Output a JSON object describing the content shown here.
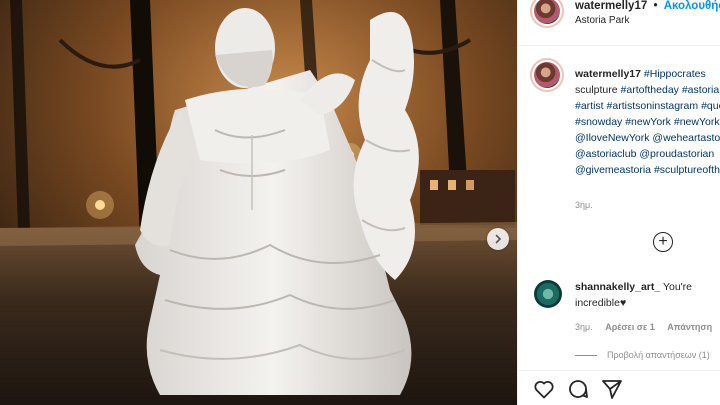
{
  "header": {
    "username": "watermelly17",
    "separator": "•",
    "follow_label": "Ακολουθήστε",
    "location": "Astoria Park"
  },
  "caption": {
    "username": "watermelly17",
    "text_parts": [
      {
        "kind": "tag",
        "text": "#Hippocrates"
      },
      {
        "kind": "text",
        "text": " sculpture "
      },
      {
        "kind": "tag",
        "text": "#artoftheday"
      },
      {
        "kind": "text",
        "text": " "
      },
      {
        "kind": "tag",
        "text": "#astoria"
      },
      {
        "kind": "text",
        "text": " "
      },
      {
        "kind": "tag",
        "text": "#artist"
      },
      {
        "kind": "text",
        "text": " "
      },
      {
        "kind": "tag",
        "text": "#artistsoninstagram"
      },
      {
        "kind": "text",
        "text": " "
      },
      {
        "kind": "tag",
        "text": "#queens"
      },
      {
        "kind": "text",
        "text": " "
      },
      {
        "kind": "tag",
        "text": "#snowday"
      },
      {
        "kind": "text",
        "text": " "
      },
      {
        "kind": "tag",
        "text": "#newYork"
      },
      {
        "kind": "text",
        "text": " "
      },
      {
        "kind": "tag",
        "text": "#newYorkCity"
      },
      {
        "kind": "text",
        "text": " "
      },
      {
        "kind": "tag",
        "text": "@IloveNewYork"
      },
      {
        "kind": "text",
        "text": " "
      },
      {
        "kind": "tag",
        "text": "@weheartastoria"
      },
      {
        "kind": "text",
        "text": " "
      },
      {
        "kind": "tag",
        "text": "@astoriaclub"
      },
      {
        "kind": "text",
        "text": " "
      },
      {
        "kind": "tag",
        "text": "@proudastorian"
      },
      {
        "kind": "text",
        "text": " "
      },
      {
        "kind": "tag",
        "text": "@givemeastoria"
      },
      {
        "kind": "text",
        "text": " "
      },
      {
        "kind": "tag",
        "text": "#sculptureoftheday"
      }
    ],
    "time": "3ημ."
  },
  "load_more": {
    "icon": "plus-circle-icon"
  },
  "comment": {
    "username": "shannakelly_art_",
    "text": " You're incredible♥",
    "time": "3ημ.",
    "likes": "Αρέσει σε 1",
    "reply": "Απάντηση",
    "view_replies": "Προβολή απαντήσεων (1)"
  },
  "actions": {
    "like_icon": "heart-icon",
    "comment_icon": "comment-icon",
    "share_icon": "paper-plane-icon"
  },
  "photo": {
    "next_icon": "chevron-right-icon"
  }
}
